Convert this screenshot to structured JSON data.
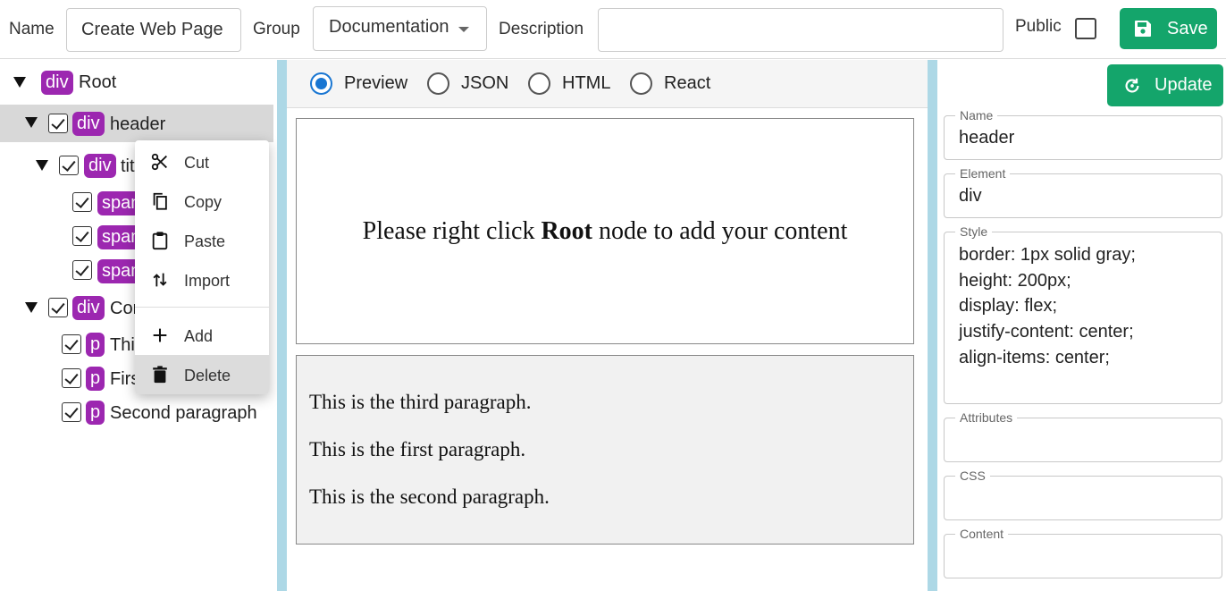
{
  "topbar": {
    "name_label": "Name",
    "name_value": "Create Web Page",
    "group_label": "Group",
    "group_value": "Documentation",
    "description_label": "Description",
    "description_value": "",
    "public_label": "Public",
    "public_checked": false,
    "save_label": "Save"
  },
  "tree": {
    "root": {
      "tag": "div",
      "label": "Root"
    },
    "header": {
      "tag": "div",
      "label": "header"
    },
    "title": {
      "tag": "div",
      "label": "tit"
    },
    "spans": [
      {
        "tag": "span"
      },
      {
        "tag": "span"
      },
      {
        "tag": "span"
      }
    ],
    "content": {
      "tag": "div",
      "label": "Con"
    },
    "paragraphs": [
      {
        "tag": "p",
        "label": "Thi"
      },
      {
        "tag": "p",
        "label": "Firs"
      },
      {
        "tag": "p",
        "label": "Second paragraph"
      }
    ]
  },
  "context_menu": {
    "items": [
      {
        "label": "Cut",
        "icon": "scissors-icon"
      },
      {
        "label": "Copy",
        "icon": "copy-icon"
      },
      {
        "label": "Paste",
        "icon": "clipboard-icon"
      },
      {
        "label": "Import",
        "icon": "import-arrows-icon"
      },
      {
        "label": "Add",
        "icon": "plus-icon"
      },
      {
        "label": "Delete",
        "icon": "trash-icon"
      }
    ]
  },
  "view_tabs": {
    "options": [
      "Preview",
      "JSON",
      "HTML",
      "React"
    ],
    "selected": "Preview"
  },
  "preview": {
    "header_text_before": "Please right click ",
    "header_text_bold": "Root",
    "header_text_after": " node to add your content",
    "paragraphs": [
      "This is the third paragraph.",
      "This is the first paragraph.",
      "This is the second paragraph."
    ]
  },
  "properties": {
    "update_label": "Update",
    "name_label": "Name",
    "name_value": "header",
    "element_label": "Element",
    "element_value": "div",
    "style_label": "Style",
    "style_lines": [
      "border: 1px solid gray;",
      "height: 200px;",
      "display: flex;",
      "justify-content: center;",
      "align-items: center;"
    ],
    "attributes_label": "Attributes",
    "attributes_value": "",
    "css_label": "CSS",
    "css_value": "",
    "content_label": "Content",
    "content_value": ""
  },
  "colors": {
    "accent_green": "#14a56b",
    "tag_purple": "#9c27b0",
    "radio_blue": "#1976d2",
    "splitter": "#add8e6"
  }
}
